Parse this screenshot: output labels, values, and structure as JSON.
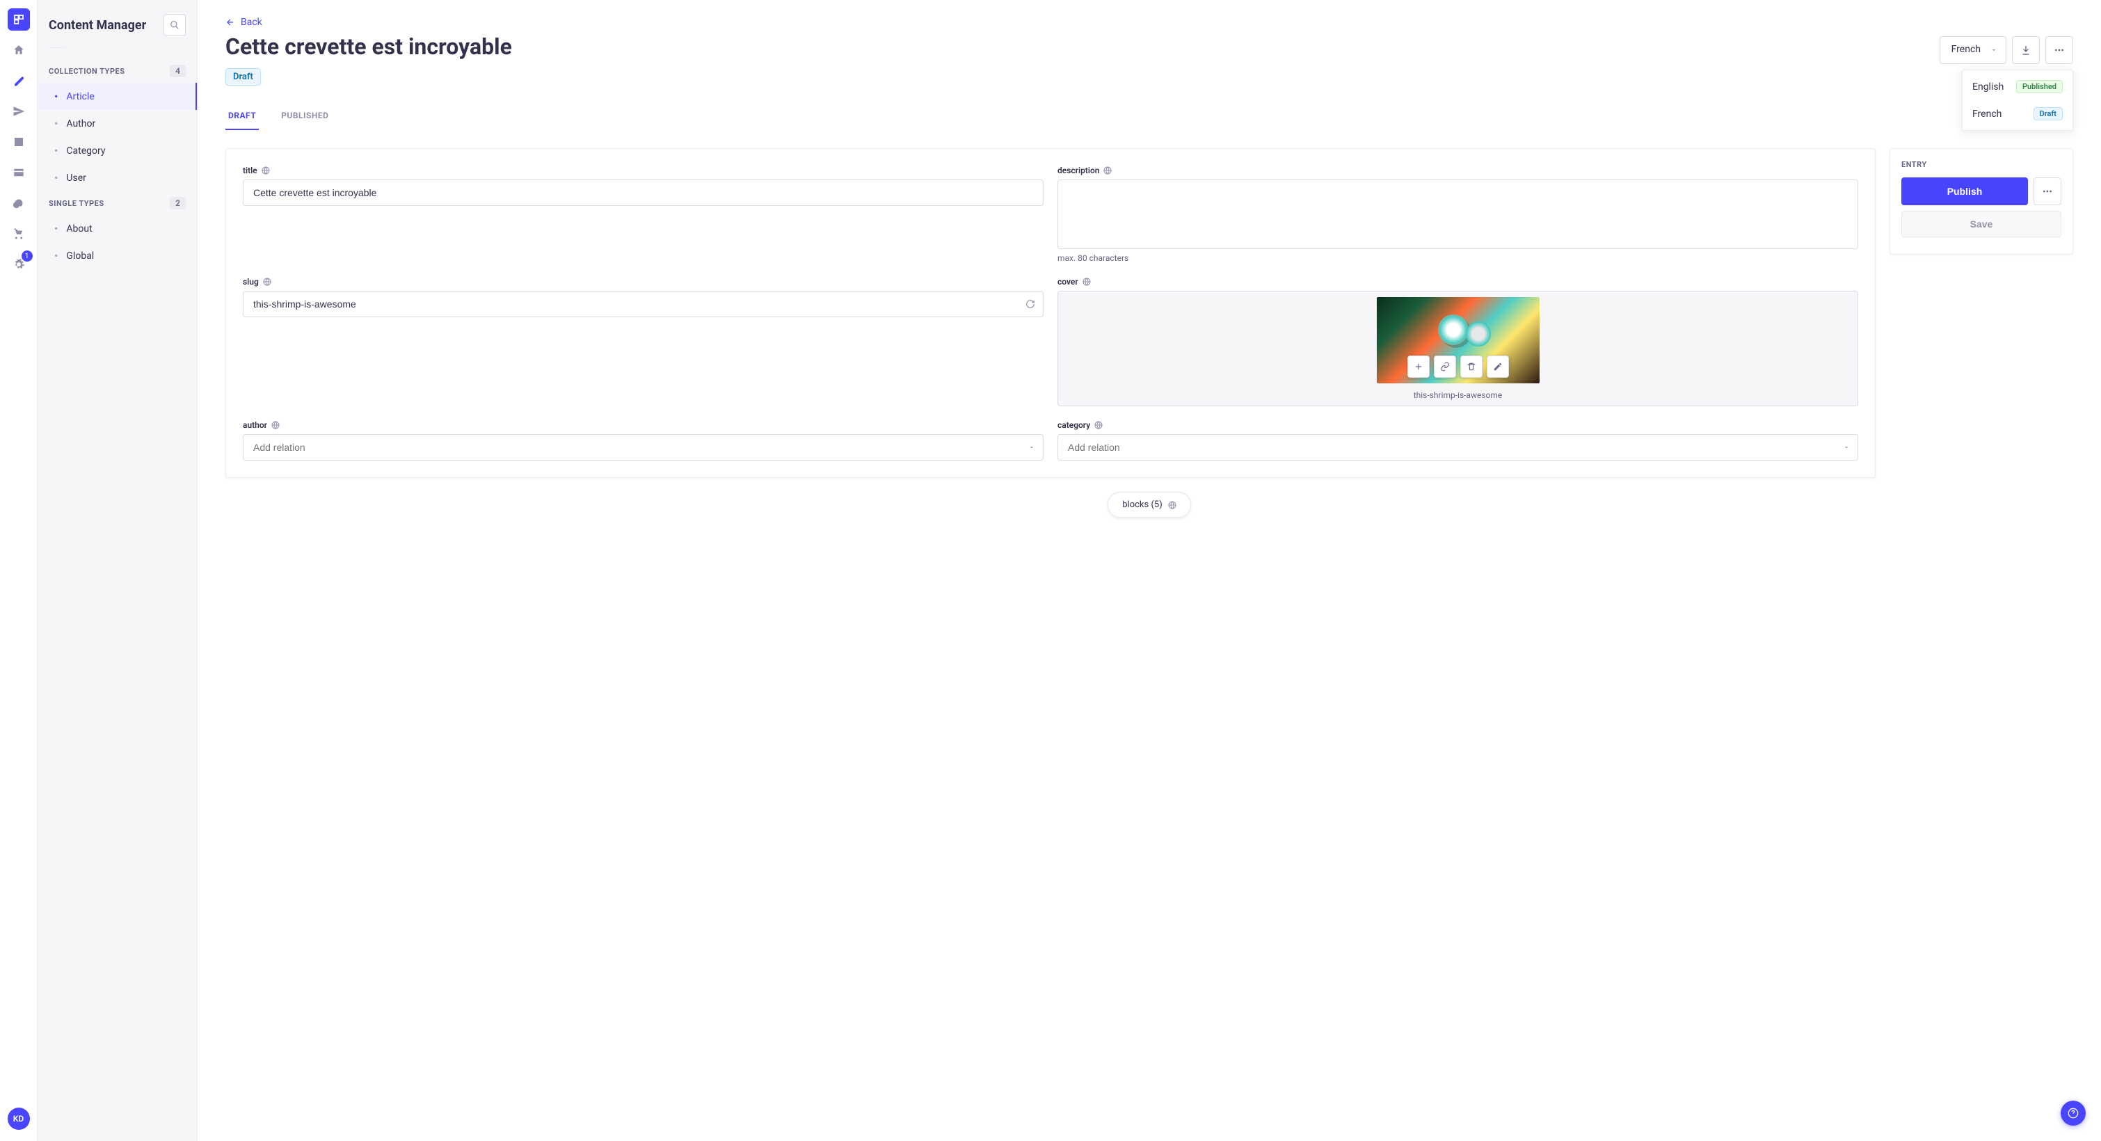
{
  "sidebar": {
    "title": "Content Manager",
    "collection_types_label": "COLLECTION TYPES",
    "collection_types_count": "4",
    "collection_items": [
      "Article",
      "Author",
      "Category",
      "User"
    ],
    "single_types_label": "SINGLE TYPES",
    "single_types_count": "2",
    "single_items": [
      "About",
      "Global"
    ]
  },
  "rail": {
    "settings_badge": "1",
    "avatar_initials": "KD"
  },
  "header": {
    "back_label": "Back",
    "title": "Cette crevette est incroyable",
    "status_badge": "Draft",
    "locale_selected": "French"
  },
  "locale_dropdown": {
    "options": [
      {
        "name": "English",
        "status": "Published",
        "status_class": "published"
      },
      {
        "name": "French",
        "status": "Draft",
        "status_class": "draft"
      }
    ]
  },
  "tabs": {
    "draft": "DRAFT",
    "published": "PUBLISHED"
  },
  "fields": {
    "title_label": "title",
    "title_value": "Cette crevette est incroyable",
    "description_label": "description",
    "description_value": "",
    "description_hint": "max. 80 characters",
    "slug_label": "slug",
    "slug_value": "this-shrimp-is-awesome",
    "cover_label": "cover",
    "cover_caption": "this-shrimp-is-awesome",
    "author_label": "author",
    "author_placeholder": "Add relation",
    "category_label": "category",
    "category_placeholder": "Add relation"
  },
  "side": {
    "entry_label": "ENTRY",
    "publish_label": "Publish",
    "save_label": "Save"
  },
  "blocks": {
    "label": "blocks (5)"
  }
}
